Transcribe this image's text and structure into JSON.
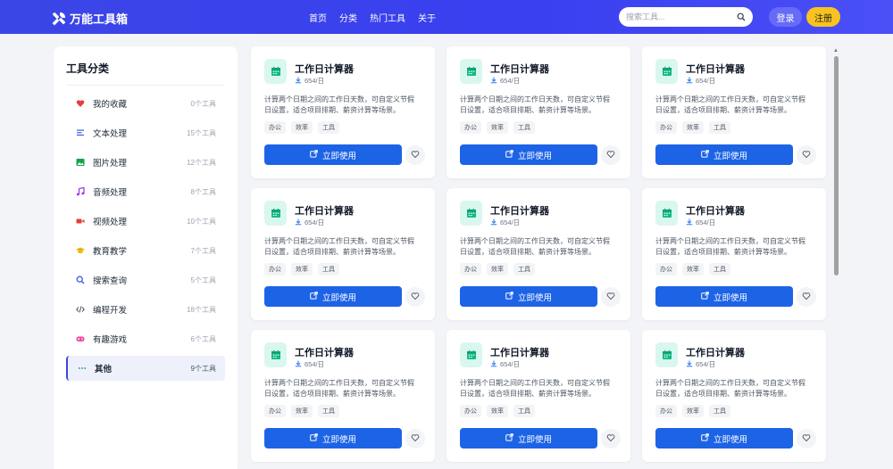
{
  "header": {
    "logo_text": "万能工具箱",
    "nav": [
      "首页",
      "分类",
      "热门工具",
      "关于"
    ],
    "search_placeholder": "搜索工具...",
    "login_label": "登录",
    "register_label": "注册"
  },
  "sidebar": {
    "title": "工具分类",
    "items": [
      {
        "label": "我的收藏",
        "count": "0个工具",
        "icon": "heart-icon",
        "color": "#e53e3e"
      },
      {
        "label": "文本处理",
        "count": "15个工具",
        "icon": "text-lines-icon",
        "color": "#3b5bdb"
      },
      {
        "label": "图片处理",
        "count": "12个工具",
        "icon": "image-icon",
        "color": "#16a34a"
      },
      {
        "label": "音频处理",
        "count": "8个工具",
        "icon": "music-note-icon",
        "color": "#9333ea"
      },
      {
        "label": "视频处理",
        "count": "10个工具",
        "icon": "video-camera-icon",
        "color": "#e53e3e"
      },
      {
        "label": "教育教学",
        "count": "7个工具",
        "icon": "graduation-cap-icon",
        "color": "#eab308"
      },
      {
        "label": "搜索查询",
        "count": "5个工具",
        "icon": "search-icon",
        "color": "#3b5bdb"
      },
      {
        "label": "编程开发",
        "count": "18个工具",
        "icon": "code-icon",
        "color": "#4b5563"
      },
      {
        "label": "有趣游戏",
        "count": "6个工具",
        "icon": "gamepad-icon",
        "color": "#ec4899"
      },
      {
        "label": "其他",
        "count": "9个工具",
        "icon": "ellipsis-icon",
        "color": "#0d9488",
        "active": true
      }
    ]
  },
  "cards": [
    {
      "title": "工作日计算器",
      "downloads": "654/日",
      "desc_line1": "计算两个日期之间的工作日天数，可自定义节假",
      "desc_line2": "日设置，适合项目排期、薪资计算等场景。",
      "tags": [
        "办公",
        "效率",
        "工具"
      ],
      "button": "立即使用"
    },
    {
      "title": "工作日计算器",
      "downloads": "654/日",
      "desc_line1": "计算两个日期之间的工作日天数，可自定义节假",
      "desc_line2": "日设置，适合项目排期、薪资计算等场景。",
      "tags": [
        "办公",
        "效率",
        "工具"
      ],
      "button": "立即使用"
    },
    {
      "title": "工作日计算器",
      "downloads": "654/日",
      "desc_line1": "计算两个日期之间的工作日天数，可自定义节假",
      "desc_line2": "日设置，适合项目排期、薪资计算等场景。",
      "tags": [
        "办公",
        "效率",
        "工具"
      ],
      "button": "立即使用"
    },
    {
      "title": "工作日计算器",
      "downloads": "654/日",
      "desc_line1": "计算两个日期之间的工作日天数，可自定义节假",
      "desc_line2": "日设置，适合项目排期、薪资计算等场景。",
      "tags": [
        "办公",
        "效率",
        "工具"
      ],
      "button": "立即使用"
    },
    {
      "title": "工作日计算器",
      "downloads": "654/日",
      "desc_line1": "计算两个日期之间的工作日天数，可自定义节假",
      "desc_line2": "日设置，适合项目排期、薪资计算等场景。",
      "tags": [
        "办公",
        "效率",
        "工具"
      ],
      "button": "立即使用"
    },
    {
      "title": "工作日计算器",
      "downloads": "654/日",
      "desc_line1": "计算两个日期之间的工作日天数，可自定义节假",
      "desc_line2": "日设置，适合项目排期、薪资计算等场景。",
      "tags": [
        "办公",
        "效率",
        "工具"
      ],
      "button": "立即使用"
    },
    {
      "title": "工作日计算器",
      "downloads": "654/日",
      "desc_line1": "计算两个日期之间的工作日天数，可自定义节假",
      "desc_line2": "日设置，适合项目排期、薪资计算等场景。",
      "tags": [
        "办公",
        "效率",
        "工具"
      ],
      "button": "立即使用"
    },
    {
      "title": "工作日计算器",
      "downloads": "654/日",
      "desc_line1": "计算两个日期之间的工作日天数，可自定义节假",
      "desc_line2": "日设置，适合项目排期、薪资计算等场景。",
      "tags": [
        "办公",
        "效率",
        "工具"
      ],
      "button": "立即使用"
    },
    {
      "title": "工作日计算器",
      "downloads": "654/日",
      "desc_line1": "计算两个日期之间的工作日天数，可自定义节假",
      "desc_line2": "日设置，适合项目排期、薪资计算等场景。",
      "tags": [
        "办公",
        "效率",
        "工具"
      ],
      "button": "立即使用"
    }
  ],
  "colors": {
    "header": "#3b46e6",
    "primary_button": "#1d63e6",
    "register_button": "#f7c320",
    "card_icon_bg": "#d9f7ef",
    "card_icon": "#10b981"
  }
}
